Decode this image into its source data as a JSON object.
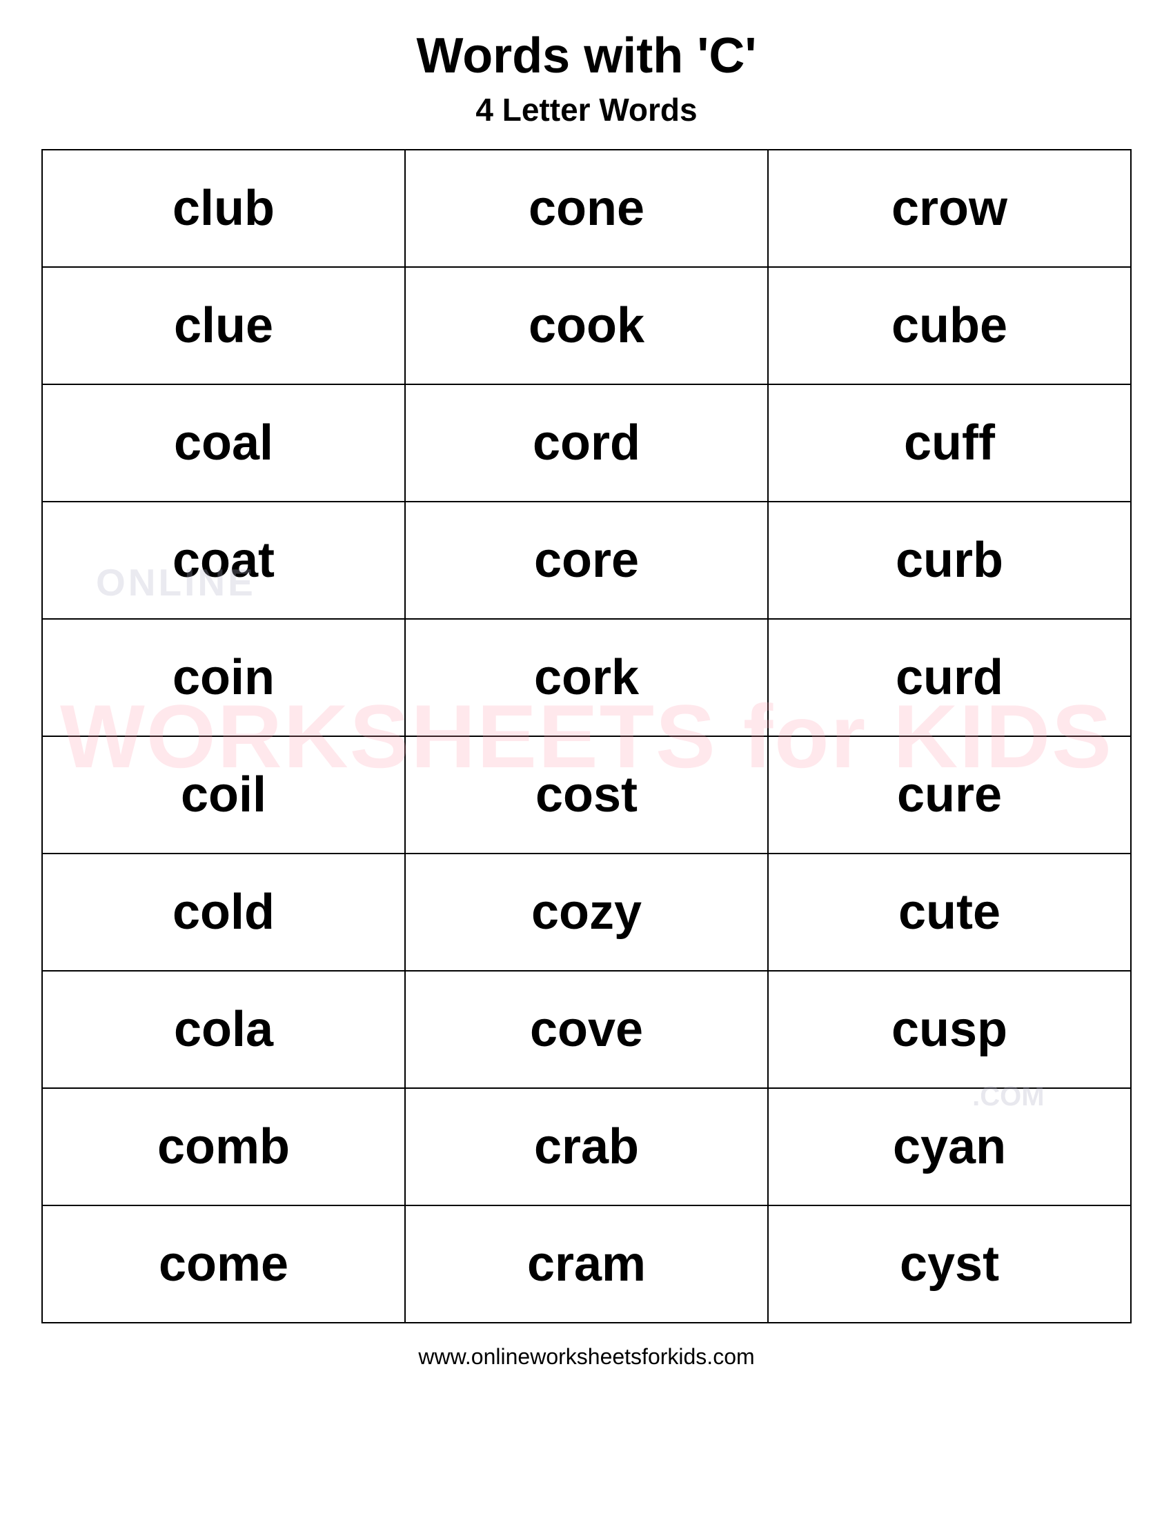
{
  "header": {
    "title": "Words with 'C'",
    "subtitle": "4 Letter Words"
  },
  "table": {
    "rows": [
      [
        "club",
        "cone",
        "crow"
      ],
      [
        "clue",
        "cook",
        "cube"
      ],
      [
        "coal",
        "cord",
        "cuff"
      ],
      [
        "coat",
        "core",
        "curb"
      ],
      [
        "coin",
        "cork",
        "curd"
      ],
      [
        "coil",
        "cost",
        "cure"
      ],
      [
        "cold",
        "cozy",
        "cute"
      ],
      [
        "cola",
        "cove",
        "cusp"
      ],
      [
        "comb",
        "crab",
        "cyan"
      ],
      [
        "come",
        "cram",
        "cyst"
      ]
    ]
  },
  "watermark": {
    "online": "ONLINE",
    "main": "WORKSHEETS for KIDS",
    "com": ".COM"
  },
  "footer": {
    "url": "www.onlineworksheetsforkids.com"
  }
}
